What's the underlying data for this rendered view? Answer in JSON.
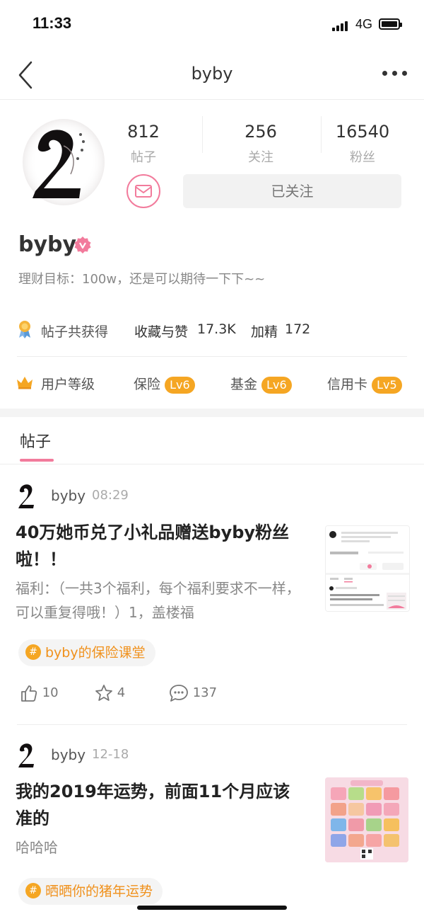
{
  "status_bar": {
    "time": "11:33",
    "network": "4G"
  },
  "nav": {
    "title": "byby"
  },
  "profile": {
    "stats": [
      {
        "value": "812",
        "label": "帖子"
      },
      {
        "value": "256",
        "label": "关注"
      },
      {
        "value": "16540",
        "label": "粉丝"
      }
    ],
    "follow_label": "已关注",
    "name": "byby",
    "bio": "理财目标：100w，还是可以期待一下下~~",
    "achievements": {
      "label": "帖子共获得",
      "likes_label": "收藏与赞",
      "likes_value": "17.3K",
      "featured_label": "加精",
      "featured_value": "172"
    },
    "levels": {
      "label": "用户等级",
      "items": [
        {
          "name": "保险",
          "level": "Lv6"
        },
        {
          "name": "基金",
          "level": "Lv6"
        },
        {
          "name": "信用卡",
          "level": "Lv5"
        }
      ]
    }
  },
  "tabs": {
    "posts_label": "帖子"
  },
  "posts": [
    {
      "author": "byby",
      "time": "08:29",
      "title": "40万她币兑了小礼品赠送byby粉丝啦！！",
      "excerpt": "福利：（一共3个福利，每个福利要求不一样，可以重复得哦！）1，盖楼福",
      "tag": "byby的保险课堂",
      "likes": "10",
      "favorites": "4",
      "comments": "137"
    },
    {
      "author": "byby",
      "time": "12-18",
      "title": "我的2019年运势，前面11个月应该准的",
      "excerpt": "哈哈哈",
      "tag": "晒晒你的猪年运势"
    }
  ],
  "colors": {
    "accent_pink": "#f27b9c",
    "level_orange": "#f5a623",
    "tag_orange": "#f0911c"
  }
}
